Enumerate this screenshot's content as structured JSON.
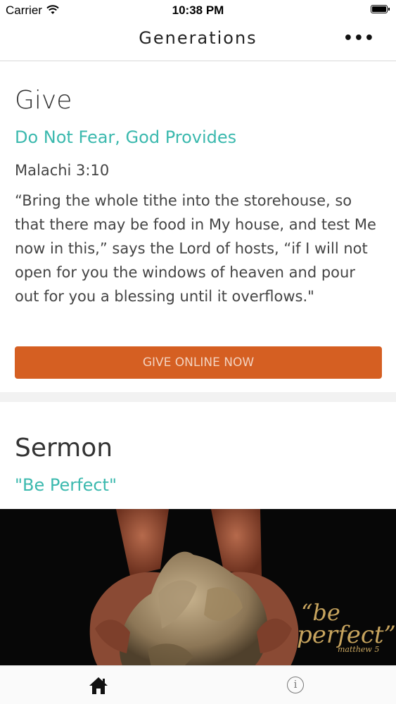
{
  "status_bar": {
    "carrier": "Carrier",
    "time": "10:38 PM"
  },
  "nav": {
    "title": "Generations",
    "more_icon": "ellipsis-icon"
  },
  "give": {
    "heading": "Give",
    "subtitle": "Do Not Fear, God Provides",
    "reference": "Malachi 3:10",
    "verse": "“Bring the whole tithe into the storehouse, so that there may be food in My house, and test Me now in this,” says the Lord of hosts, “if I will not open for you the windows of heaven and pour out for you a blessing until it overflows.\"",
    "button_label": "GIVE ONLINE NOW",
    "button_color": "#d55f22",
    "subtitle_color": "#3bb9ae"
  },
  "sermon": {
    "heading": "Sermon",
    "subtitle": "\"Be Perfect\"",
    "image_text_line1": "“be",
    "image_text_line2": "perfect”",
    "image_caption": "matthew 5"
  },
  "tabs": {
    "home_icon": "home-icon",
    "info_icon": "info-icon",
    "info_glyph": "i"
  }
}
